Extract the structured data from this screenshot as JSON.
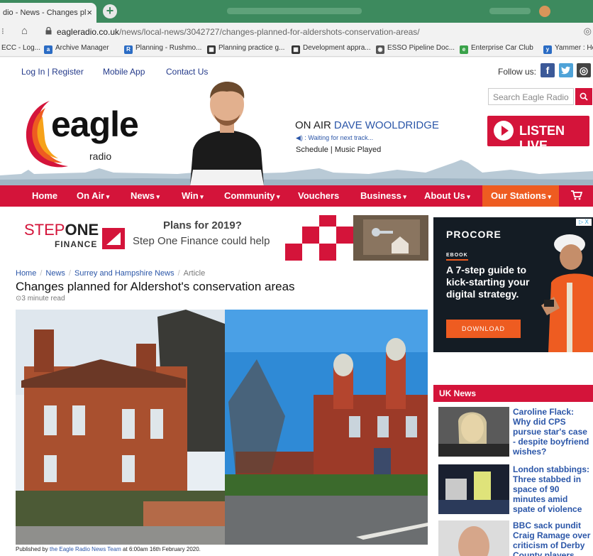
{
  "browser": {
    "tab_title": "dio - News - Changes pl",
    "tab_close": "×",
    "new_tab": "+",
    "kebab": "⁝",
    "home": "⌂",
    "lock": "🔒",
    "url_host": "eagleradio.co.uk",
    "url_path": "/news/local-news/3042727/changes-planned-for-aldershots-conservation-areas/",
    "extension_icon": "◎",
    "bookmarks": [
      {
        "label": "ECC - Log...",
        "icon": "",
        "color": ""
      },
      {
        "label": "Archive Manager",
        "icon": "a",
        "color": "#2b6cc4"
      },
      {
        "label": "Planning - Rushmo...",
        "icon": "R",
        "color": "#2b6cc4"
      },
      {
        "label": "Planning practice g...",
        "icon": "▦",
        "color": "#333333"
      },
      {
        "label": "Development appra...",
        "icon": "▦",
        "color": "#333333"
      },
      {
        "label": "ESSO Pipeline Doc...",
        "icon": "◉",
        "color": "#555555"
      },
      {
        "label": "Enterprise Car Club",
        "icon": "e",
        "color": "#3aa24a"
      },
      {
        "label": "Yammer : Home",
        "icon": "y",
        "color": "#2b6cc4"
      }
    ]
  },
  "header": {
    "login": "Log In | Register",
    "mobile_app": "Mobile App",
    "contact": "Contact Us",
    "follow": "Follow us:",
    "facebook": "f",
    "twitter": "t",
    "instagram": "◎",
    "search_placeholder": "Search Eagle Radio",
    "search_icon": "🔍",
    "logo_text": "eagle",
    "logo_sub": "radio",
    "on_air": "ON AIR",
    "presenter": "DAVE WOOLDRIDGE",
    "now_playing": "◀) : Waiting for next track...",
    "schedule": "Schedule  |  Music Played",
    "listen_live": "LISTEN LIVE"
  },
  "nav": {
    "items": [
      "Home",
      "On Air",
      "News",
      "Win",
      "Community",
      "Vouchers",
      "Business",
      "About Us",
      "Our Stations"
    ],
    "cart_icon": "🛒"
  },
  "ad_banner": {
    "brand_step": "STEP",
    "brand_one": "ONE",
    "brand_finance": "FINANCE",
    "headline": "Plans for 2019?",
    "subline": "Step One Finance could help"
  },
  "article": {
    "breadcrumb": [
      "Home",
      "News",
      "Surrey and Hampshire News",
      "Article"
    ],
    "title": "Changes planned for Aldershot's conservation areas",
    "read_time": "⊙3 minute read",
    "published_prefix": "Published by ",
    "published_team": "the Eagle Radio News Team",
    "published_suffix": " at 6:00am 16th February 2020."
  },
  "side_ad": {
    "brand": "PROCORE",
    "tag": "EBOOK",
    "headline": "A 7-step guide to kick-starting your digital strategy.",
    "cta": "DOWNLOAD",
    "adchoice": "▷ X"
  },
  "uk_news": {
    "title": "UK News",
    "items": [
      "Caroline Flack: Why did CPS pursue star's case - despite boyfriend wishes?",
      "London stabbings: Three stabbed in space of 90 minutes amid spate of violence",
      "BBC sack pundit Craig Ramage over criticism of Derby County players"
    ]
  },
  "colors": {
    "brand_red": "#d4143a",
    "brand_orange": "#ee5c21",
    "link_blue": "#2b56a8",
    "chrome_green": "#3d8a5e"
  }
}
